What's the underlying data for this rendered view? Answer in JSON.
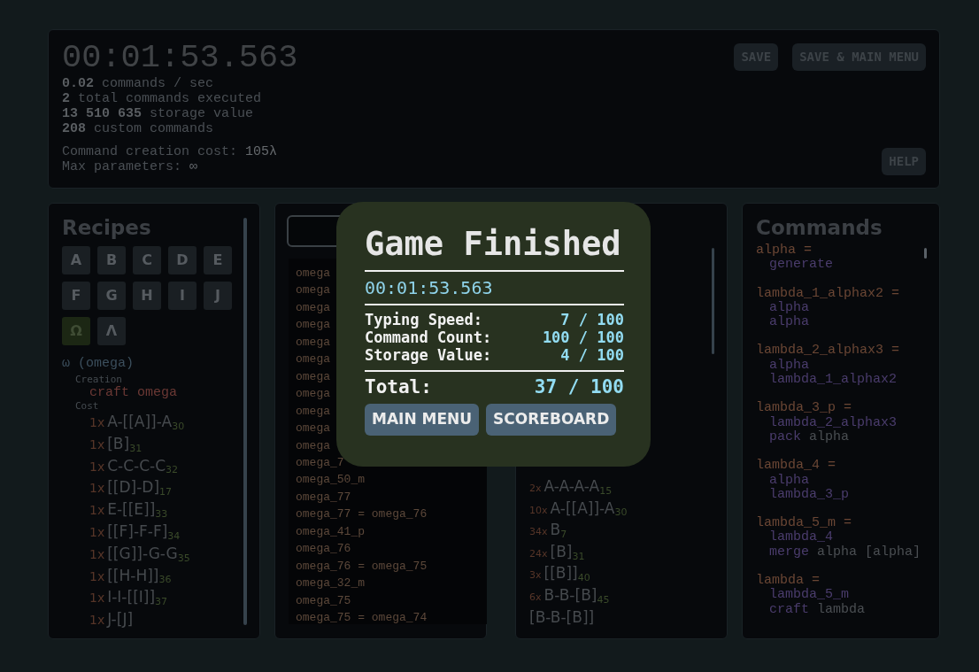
{
  "stats": {
    "timer": "00:01:53.563",
    "lines": [
      {
        "amount": "0.02",
        "unit": "commands / sec"
      },
      {
        "amount": "2",
        "unit": "total commands executed"
      },
      {
        "amount": "13 510 635",
        "unit": "storage value"
      },
      {
        "amount": "208",
        "unit": "custom commands"
      }
    ],
    "settings": [
      {
        "label": "Command creation cost:",
        "value": "105λ"
      },
      {
        "label": "Max parameters:",
        "value": "∞"
      }
    ]
  },
  "top_buttons": [
    "SAVE",
    "SAVE & MAIN MENU"
  ],
  "help_button": "HELP",
  "recipes": {
    "title": "Recipes",
    "letters": [
      {
        "label": "A",
        "selected": false
      },
      {
        "label": "B",
        "selected": false
      },
      {
        "label": "C",
        "selected": false
      },
      {
        "label": "D",
        "selected": false
      },
      {
        "label": "E",
        "selected": false
      },
      {
        "label": "F",
        "selected": false
      },
      {
        "label": "G",
        "selected": false
      },
      {
        "label": "H",
        "selected": false
      },
      {
        "label": "I",
        "selected": false
      },
      {
        "label": "J",
        "selected": false
      },
      {
        "label": "Ω",
        "selected": true
      },
      {
        "label": "Λ",
        "selected": false
      }
    ],
    "detail": {
      "symbol": "ω",
      "name": "(omega)",
      "creation_label": "Creation",
      "creation": "craft omega",
      "cost_label": "Cost",
      "cost": [
        {
          "count": "1x",
          "recipe": "A-[[A]]-A",
          "index": "30"
        },
        {
          "count": "1x",
          "recipe": "[B]",
          "index": "31"
        },
        {
          "count": "1x",
          "recipe": "C-C-C-C",
          "index": "32"
        },
        {
          "count": "1x",
          "recipe": "[[D]-D]",
          "index": "17"
        },
        {
          "count": "1x",
          "recipe": "E-[[E]]",
          "index": "33"
        },
        {
          "count": "1x",
          "recipe": "[[F]-F-F]",
          "index": "34"
        },
        {
          "count": "1x",
          "recipe": "[[G]]-G-G",
          "index": "35"
        },
        {
          "count": "1x",
          "recipe": "[[H-H]]",
          "index": "36"
        },
        {
          "count": "1x",
          "recipe": "I-I-[[I]]",
          "index": "37"
        },
        {
          "count": "1x",
          "recipe": "J-[J]"
        }
      ]
    }
  },
  "log": {
    "lines": [
      "omega",
      "omega",
      "omega",
      "omega",
      "omega",
      "omega",
      "omega",
      "omega",
      "omega",
      "omega",
      "omega",
      "omega_7",
      "omega_50_m",
      "omega_77",
      "omega_77 = omega_76",
      "omega_41_p",
      "omega_76",
      "omega_76 = omega_75",
      "omega_32_m",
      "omega_75",
      "omega_75 = omega_74"
    ]
  },
  "inventory": {
    "items": [
      {
        "count": "2x",
        "recipe": "A-A-A-A",
        "index": "15"
      },
      {
        "count": "10x",
        "recipe": "A-[[A]]-A",
        "index": "30"
      },
      {
        "count": "34x",
        "recipe": "B",
        "index": "7"
      },
      {
        "count": "24x",
        "recipe": "[B]",
        "index": "31"
      },
      {
        "count": "3x",
        "recipe": "[[B]]",
        "index": "40"
      },
      {
        "count": "6x",
        "recipe": "B-B-[B]",
        "index": "45"
      },
      {
        "recipe": "[B-B-[B]]"
      }
    ]
  },
  "commands": {
    "title": "Commands",
    "definitions": [
      {
        "name": "alpha =",
        "body": [
          {
            "kind": "op",
            "op": "generate"
          }
        ]
      },
      {
        "name": "lambda_1_alphax2 =",
        "body": [
          {
            "kind": "ref",
            "text": "alpha"
          },
          {
            "kind": "ref",
            "text": "alpha"
          }
        ]
      },
      {
        "name": "lambda_2_alphax3 =",
        "body": [
          {
            "kind": "ref",
            "text": "alpha"
          },
          {
            "kind": "ref",
            "text": "lambda_1_alphax2"
          }
        ]
      },
      {
        "name": "lambda_3_p =",
        "body": [
          {
            "kind": "ref",
            "text": "lambda_2_alphax3"
          },
          {
            "kind": "op",
            "op": "pack",
            "args": "alpha"
          }
        ]
      },
      {
        "name": "lambda_4 =",
        "body": [
          {
            "kind": "ref",
            "text": "alpha"
          },
          {
            "kind": "ref",
            "text": "lambda_3_p"
          }
        ]
      },
      {
        "name": "lambda_5_m =",
        "body": [
          {
            "kind": "ref",
            "text": "lambda_4"
          },
          {
            "kind": "op",
            "op": "merge",
            "args": "alpha [alpha]"
          }
        ]
      },
      {
        "name": "lambda =",
        "body": [
          {
            "kind": "ref",
            "text": "lambda_5_m"
          },
          {
            "kind": "op",
            "op": "craft",
            "args": "lambda"
          }
        ]
      }
    ]
  },
  "dialog": {
    "title": "Game Finished",
    "time": "00:01:53.563",
    "scores": [
      {
        "label": "Typing Speed:",
        "value": "7 / 100"
      },
      {
        "label": "Command Count:",
        "value": "100 / 100"
      },
      {
        "label": "Storage Value:",
        "value": "4 / 100"
      }
    ],
    "total": {
      "label": "Total:",
      "value": "37 / 100"
    },
    "buttons": [
      "MAIN MENU",
      "SCOREBOARD"
    ]
  }
}
